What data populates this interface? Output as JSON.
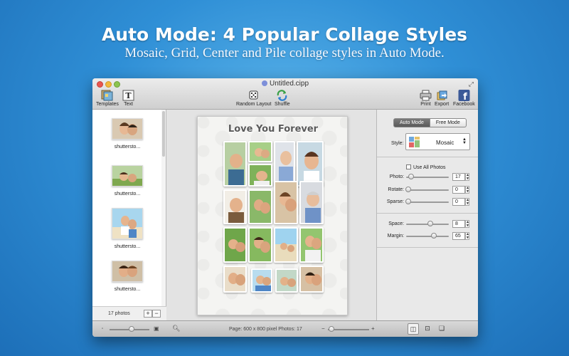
{
  "banner": {
    "headline": "Auto Mode: 4 Popular Collage Styles",
    "subline": "Mosaic, Grid, Center and Pile collage styles in Auto Mode."
  },
  "window": {
    "title": "Untitled.cipp"
  },
  "toolbar": {
    "templates": "Templates",
    "text": "Text",
    "random_layout": "Random Layout",
    "shuffle": "Shuffle",
    "print": "Print",
    "export": "Export",
    "facebook": "Facebook"
  },
  "photo_list": {
    "items": [
      {
        "label": "shuttersto..."
      },
      {
        "label": "shuttersto..."
      },
      {
        "label": "shuttersto..."
      },
      {
        "label": "shuttersto..."
      }
    ],
    "count": "17 photos",
    "add": "+",
    "remove": "−"
  },
  "collage": {
    "title": "Love You Forever"
  },
  "settings": {
    "auto_mode": "Auto Mode",
    "free_mode": "Free Mode",
    "style_label": "Style:",
    "style_value": "Mosaic",
    "use_all_photos": "Use All Photos",
    "photo_label": "Photo:",
    "photo_value": "17",
    "rotate_label": "Rotate:",
    "rotate_value": "0",
    "sparse_label": "Sparse:",
    "sparse_value": "0",
    "space_label": "Space:",
    "space_value": "8",
    "margin_label": "Margin:",
    "margin_value": "65"
  },
  "statusbar": {
    "page_info": "Page: 600 x 800 pixel  Photos: 17",
    "minus": "−",
    "plus": "+"
  },
  "colors": {
    "background": "#2f8fd6",
    "accent": "#5a5a5a"
  }
}
